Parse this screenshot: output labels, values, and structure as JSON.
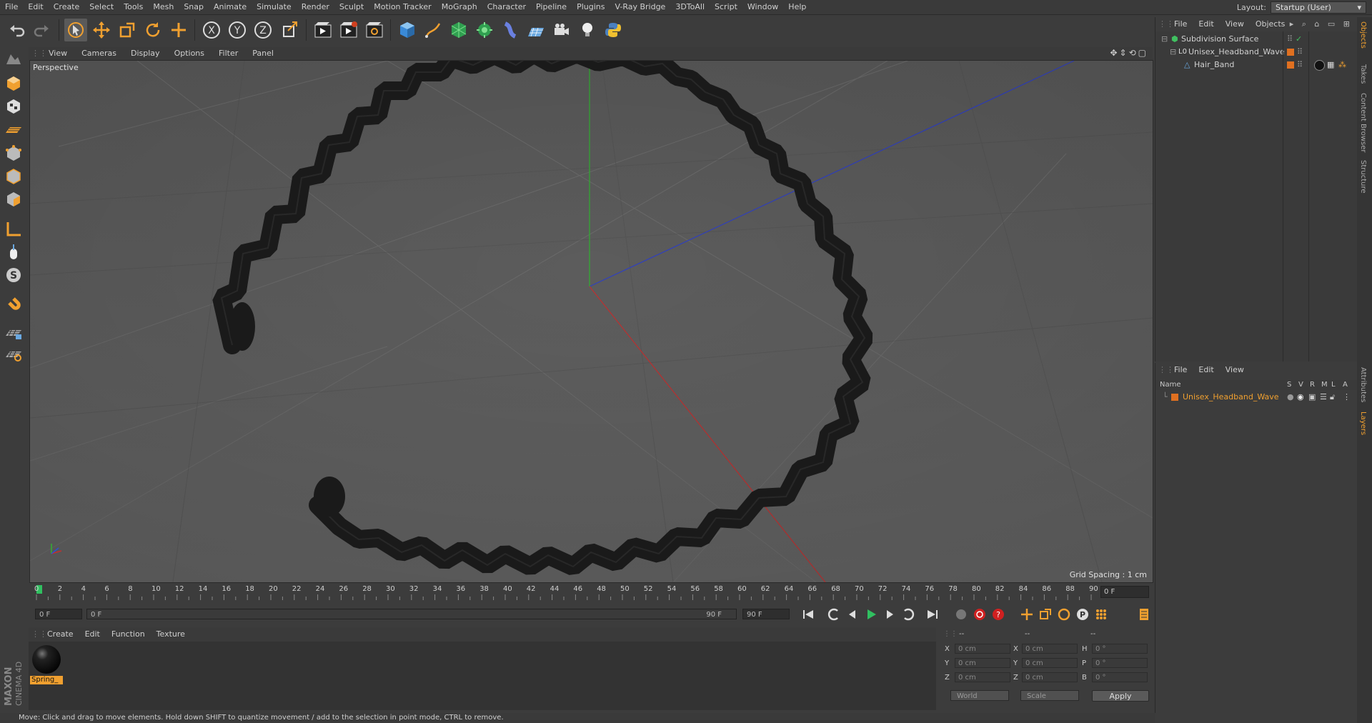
{
  "menubar": {
    "items": [
      "File",
      "Edit",
      "Create",
      "Select",
      "Tools",
      "Mesh",
      "Snap",
      "Animate",
      "Simulate",
      "Render",
      "Sculpt",
      "Motion Tracker",
      "MoGraph",
      "Character",
      "Pipeline",
      "Plugins",
      "V-Ray Bridge",
      "3DToAll",
      "Script",
      "Window",
      "Help"
    ],
    "layout_label": "Layout:",
    "layout_value": "Startup (User)"
  },
  "toolbar": {
    "icons": [
      "undo-icon",
      "redo-icon",
      "live-selection-icon",
      "move-icon",
      "scale-icon",
      "rotate-icon",
      "recent-tool-icon",
      "x-axis-icon",
      "y-axis-icon",
      "z-axis-icon",
      "coordinate-system-icon",
      "render-view-icon",
      "render-picture-viewer-icon",
      "edit-render-settings-icon",
      "cube-icon",
      "pen-icon",
      "subdivision-icon",
      "cloner-icon",
      "deformer-icon",
      "floor-icon",
      "camera-icon",
      "light-icon",
      "python-icon"
    ]
  },
  "viewport": {
    "menu": [
      "View",
      "Cameras",
      "Display",
      "Options",
      "Filter",
      "Panel"
    ],
    "label": "Perspective",
    "grid_spacing": "Grid Spacing : 1 cm"
  },
  "timeline": {
    "ticks": [
      "0",
      "2",
      "4",
      "6",
      "8",
      "10",
      "12",
      "14",
      "16",
      "18",
      "20",
      "22",
      "24",
      "26",
      "28",
      "30",
      "32",
      "34",
      "36",
      "38",
      "40",
      "42",
      "44",
      "46",
      "48",
      "50",
      "52",
      "54",
      "56",
      "58",
      "60",
      "62",
      "64",
      "66",
      "68",
      "70",
      "72",
      "74",
      "76",
      "78",
      "80",
      "82",
      "84",
      "86",
      "88",
      "90"
    ],
    "current_frame": "0 F",
    "start_field": "0 F",
    "slider_left": "0 F",
    "slider_right": "90 F",
    "end_field": "90 F"
  },
  "materials": {
    "menu": [
      "Create",
      "Edit",
      "Function",
      "Texture"
    ],
    "items": [
      {
        "name": "Spring_"
      }
    ]
  },
  "coordinates": {
    "headers": [
      "--",
      "--",
      "--"
    ],
    "rows": [
      {
        "a": "X",
        "av": "0 cm",
        "b": "X",
        "bv": "0 cm",
        "c": "H",
        "cv": "0 °"
      },
      {
        "a": "Y",
        "av": "0 cm",
        "b": "Y",
        "bv": "0 cm",
        "c": "P",
        "cv": "0 °"
      },
      {
        "a": "Z",
        "av": "0 cm",
        "b": "Z",
        "bv": "0 cm",
        "c": "B",
        "cv": "0 °"
      }
    ],
    "mode1": "World",
    "mode2": "Scale",
    "apply": "Apply"
  },
  "status": "Move: Click and drag to move elements. Hold down SHIFT to quantize movement / add to the selection in point mode, CTRL to remove.",
  "objects": {
    "menu": [
      "File",
      "Edit",
      "View",
      "Objects"
    ],
    "tree": [
      {
        "name": "Subdivision Surface",
        "indent": 0
      },
      {
        "name": "Unisex_Headband_Wave",
        "indent": 1
      },
      {
        "name": "Hair_Band",
        "indent": 2
      }
    ]
  },
  "layers": {
    "menu": [
      "File",
      "Edit",
      "View"
    ],
    "columns": [
      "Name",
      "S",
      "V",
      "R",
      "M",
      "L",
      "A"
    ],
    "items": [
      {
        "name": "Unisex_Headband_Wave",
        "color": "#e07020"
      }
    ]
  },
  "right_tabs": [
    "Objects",
    "Takes",
    "Content Browser",
    "Structure",
    "Attributes",
    "Layers"
  ],
  "logo": {
    "line1": "MAXON",
    "line2": "CINEMA 4D"
  }
}
